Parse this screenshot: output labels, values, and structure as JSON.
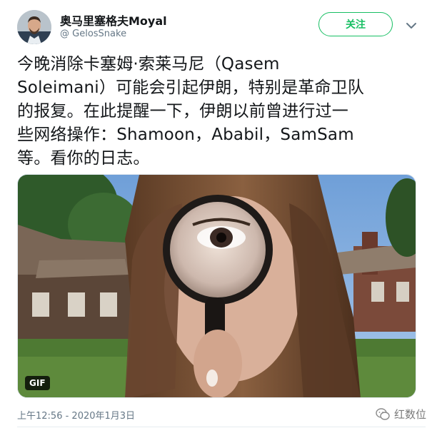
{
  "author": {
    "display_name": "奥马里塞格夫Moyal",
    "handle": "@ GelosSnake",
    "avatar_icon": "profile-photo"
  },
  "actions": {
    "follow_label": "关注",
    "more_icon": "chevron-down-icon"
  },
  "tweet": {
    "lines": [
      "今晚消除卡塞姆·索莱马尼（Qasem",
      "Soleimani）可能会引起伊朗，特别是革命卫队",
      "的报复。在此提醒一下，伊朗以前曾进行过一",
      "些网络操作：Shamoon，Ababil，SamSam",
      "等。看你的日志。"
    ]
  },
  "media": {
    "badge": "GIF"
  },
  "meta": {
    "timestamp": "上午12:56 - 2020年1月3日"
  },
  "watermark": {
    "text": "红数位",
    "icon": "wechat-icon"
  },
  "colors": {
    "follow_green": "#17bf63",
    "secondary_text": "#657786"
  }
}
